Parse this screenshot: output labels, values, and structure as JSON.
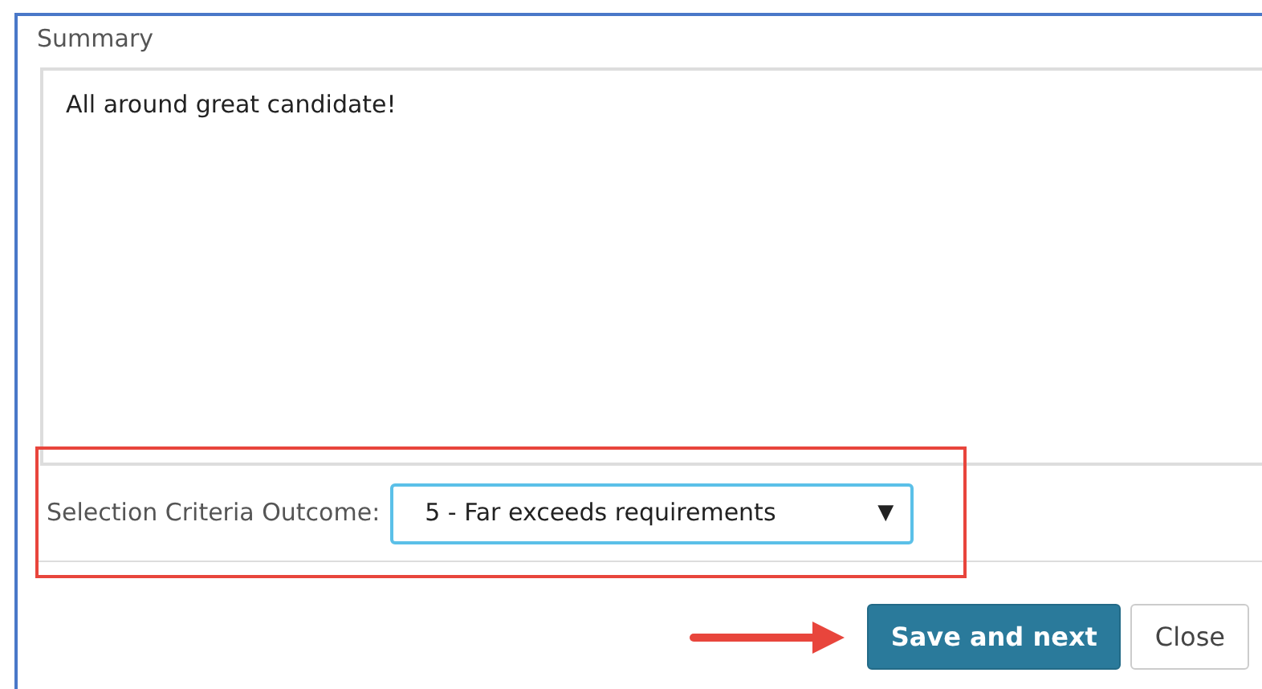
{
  "summary": {
    "label": "Summary",
    "value": "All around great candidate!"
  },
  "outcome": {
    "label": "Selection Criteria Outcome:",
    "value": "5 - Far exceeds requirements",
    "caret": "▼",
    "highlighted": true
  },
  "buttons": [
    {
      "label": "Save and next",
      "kind": "primary",
      "pointed": true
    },
    {
      "label": "Close",
      "kind": "default",
      "pointed": false
    }
  ]
}
